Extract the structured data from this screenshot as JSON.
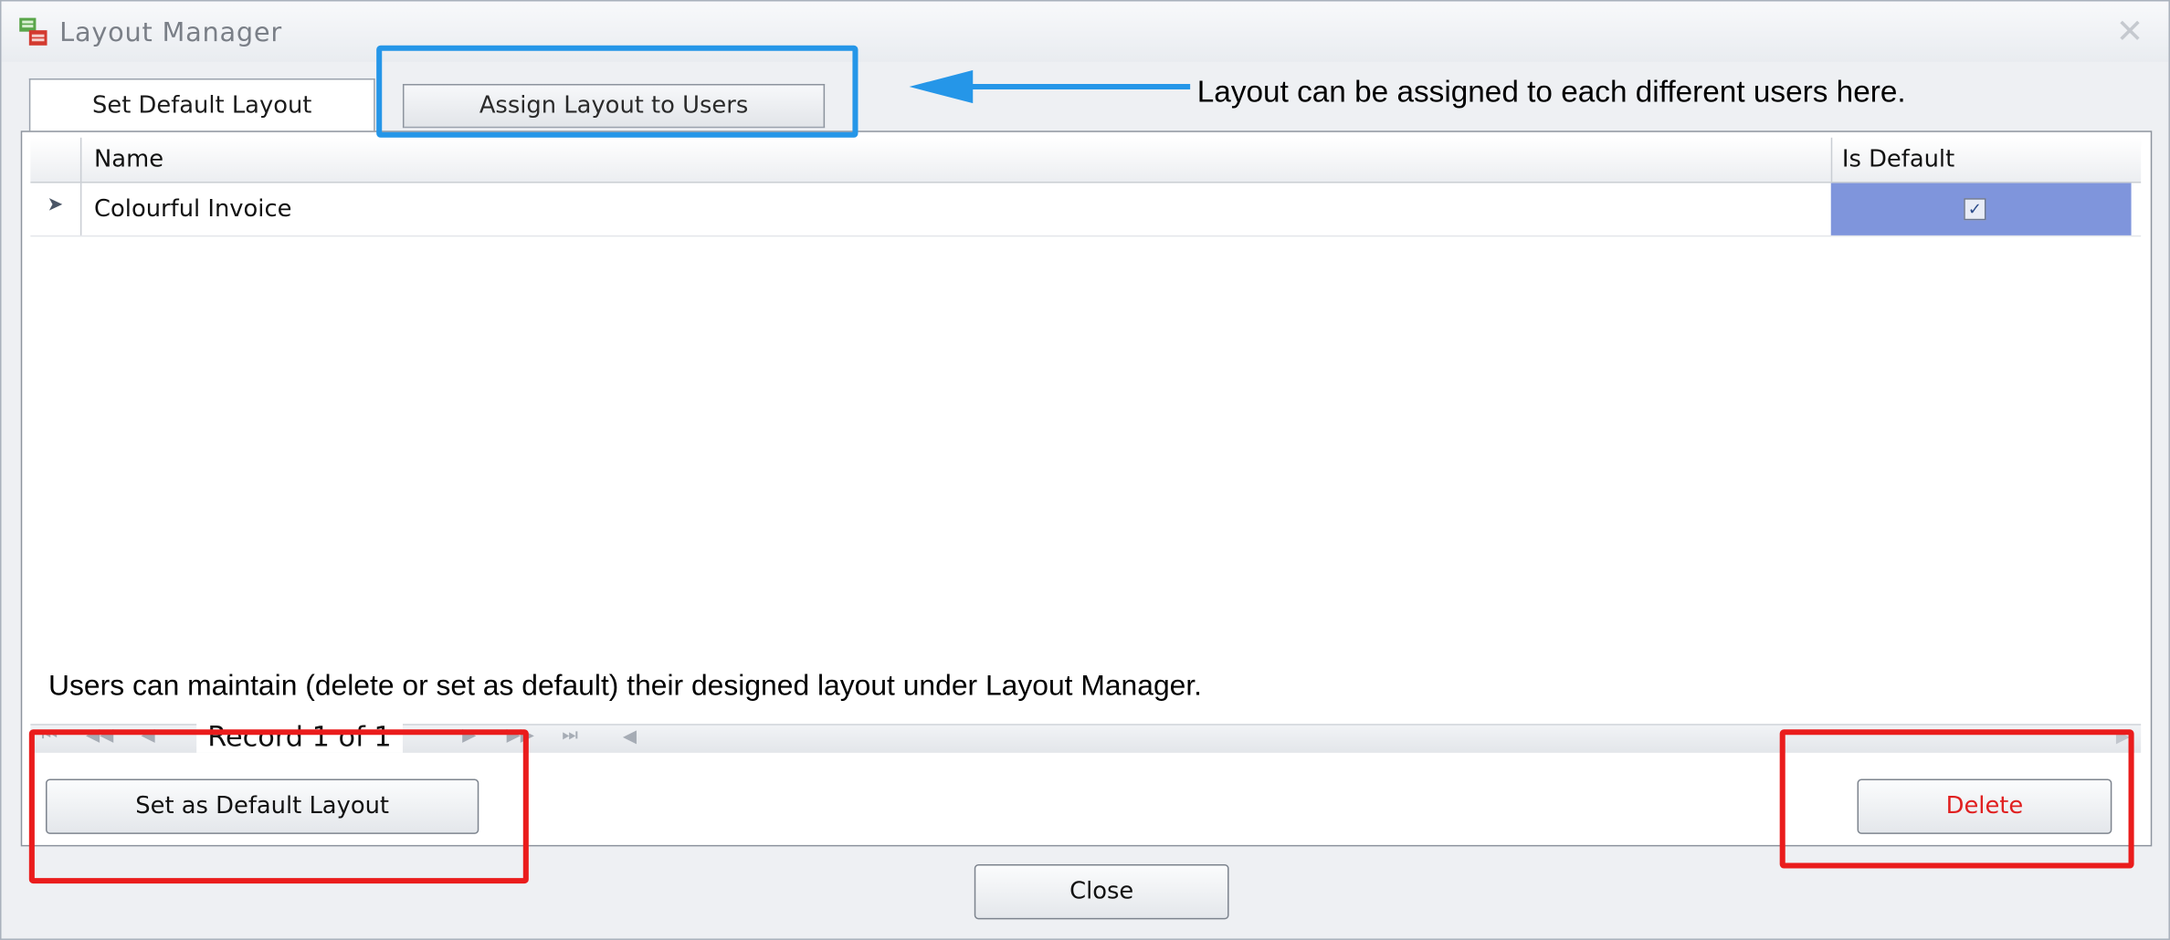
{
  "window": {
    "title": "Layout Manager",
    "close_glyph": "✕",
    "app_icon": "layout-manager-icon"
  },
  "tabs": [
    {
      "label": "Set Default Layout",
      "active": true
    },
    {
      "label": "Assign Layout to Users",
      "active": false
    }
  ],
  "grid": {
    "columns": {
      "name": "Name",
      "is_default": "Is Default"
    },
    "rows": [
      {
        "marker": "➤",
        "name": "Colourful Invoice",
        "is_default": true,
        "check": "✓"
      }
    ]
  },
  "navigator": {
    "first": "⏮",
    "prev_page": "◀◀",
    "prev": "◀",
    "record_text": "Record 1 of 1",
    "next": "▶",
    "next_page": "▶▶",
    "last": "⏭",
    "scroll_left": "◀",
    "scroll_right": "▶"
  },
  "buttons": {
    "set_default": "Set as Default Layout",
    "delete": "Delete",
    "close": "Close"
  },
  "annotations": {
    "top": "Layout can be assigned to each different users here.",
    "bottom": "Users can maintain (delete or set as default) their designed layout under Layout Manager."
  },
  "colors": {
    "highlight_blue": "#2596e8",
    "highlight_red": "#ea1c1c",
    "selected_cell": "#7f95dc",
    "delete_text": "#e02020"
  }
}
